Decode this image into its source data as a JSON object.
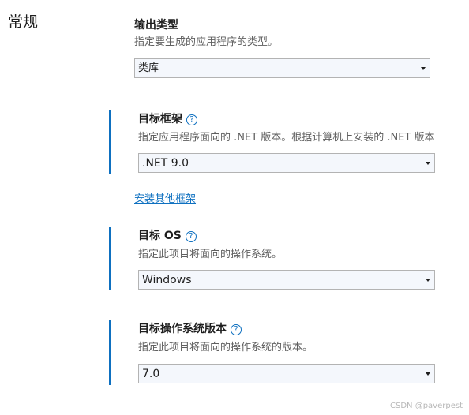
{
  "section_title": "常规",
  "output_type": {
    "title": "输出类型",
    "description": "指定要生成的应用程序的类型。",
    "selected": "类库"
  },
  "target_framework": {
    "title": "目标框架",
    "description": "指定应用程序面向的 .NET 版本。根据计算机上安装的 .NET 版本",
    "selected": ".NET 9.0",
    "install_link": "安装其他框架"
  },
  "target_os": {
    "title": "目标 OS",
    "description": "指定此项目将面向的操作系统。",
    "selected": "Windows"
  },
  "target_os_version": {
    "title": "目标操作系统版本",
    "description": "指定此项目将面向的操作系统的版本。",
    "selected": "7.0"
  },
  "help_glyph": "?",
  "watermark": "CSDN @paverpest"
}
